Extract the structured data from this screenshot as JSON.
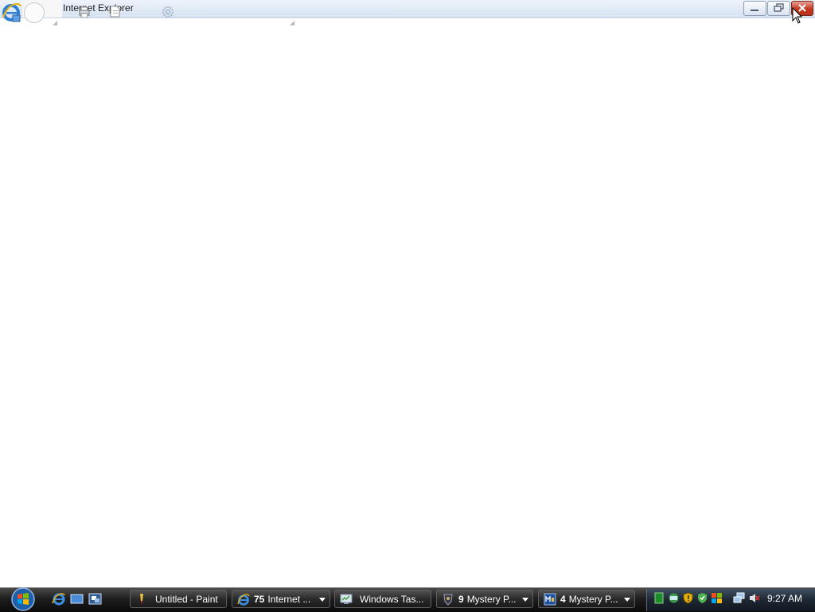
{
  "window": {
    "title": "Internet Explorer",
    "buttons": {
      "minimize": "minimize-icon",
      "restore": "restore-icon",
      "close": "close-icon"
    }
  },
  "toolbar_icons": [
    "ie-logo-icon",
    "back-icon",
    "print-icon",
    "page-icon",
    "tools-gear-icon"
  ],
  "taskbar": {
    "start": "windows-start-icon",
    "quick_launch": [
      "ie-icon",
      "show-desktop-icon",
      "switch-windows-icon"
    ],
    "buttons": [
      {
        "count": "",
        "label": "Untitled - Paint",
        "icon": "paint-icon",
        "has_menu": false
      },
      {
        "count": "75",
        "label": "Internet ...",
        "icon": "ie-icon",
        "has_menu": true
      },
      {
        "count": "",
        "label": "Windows Tas...",
        "icon": "task-manager-icon",
        "has_menu": false
      },
      {
        "count": "9",
        "label": "Mystery P...",
        "icon": "mystery-game-icon",
        "has_menu": true
      },
      {
        "count": "4",
        "label": "Mystery P...",
        "icon": "mystery-mp-icon",
        "has_menu": true
      }
    ],
    "tray_icons": [
      "green-app-icon",
      "network-sharing-icon",
      "security-shield-icon",
      "windows-update-icon",
      "network-icon",
      "volume-muted-icon"
    ],
    "clock": "9:27 AM"
  },
  "colors": {
    "taskbar_dark": "#0b0b0b",
    "title_gradient_top": "#eef3fa",
    "close_red": "#c2361d",
    "page_background": "#ffffff"
  }
}
